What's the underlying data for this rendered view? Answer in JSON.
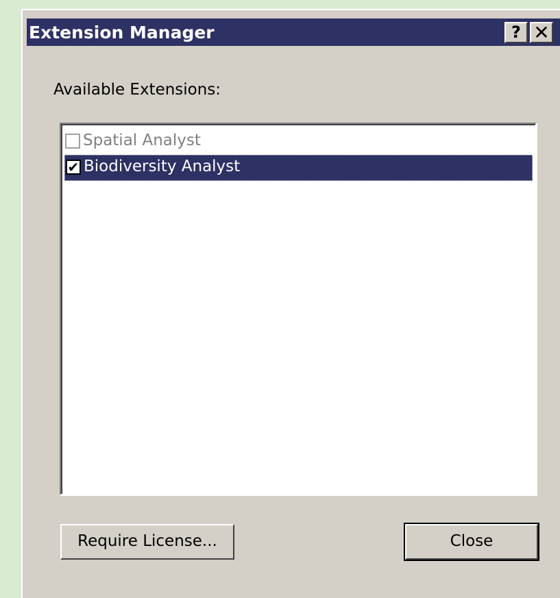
{
  "window": {
    "title": "Extension Manager",
    "help_label": "?",
    "close_label": "✕"
  },
  "available_label": "Available Extensions:",
  "extensions": [
    {
      "name": "Spatial Analyst",
      "checked": false,
      "enabled": false,
      "selected": false
    },
    {
      "name": "Biodiversity Analyst",
      "checked": true,
      "enabled": true,
      "selected": true
    }
  ],
  "check_mark": "✔",
  "buttons": {
    "require_license": "Require License...",
    "close": "Close"
  },
  "colors": {
    "titlebar": "#2e3163",
    "face": "#d4d0c8",
    "selection": "#2e3163",
    "disabled_text": "#808080",
    "desktop": "#d9ecd2"
  }
}
